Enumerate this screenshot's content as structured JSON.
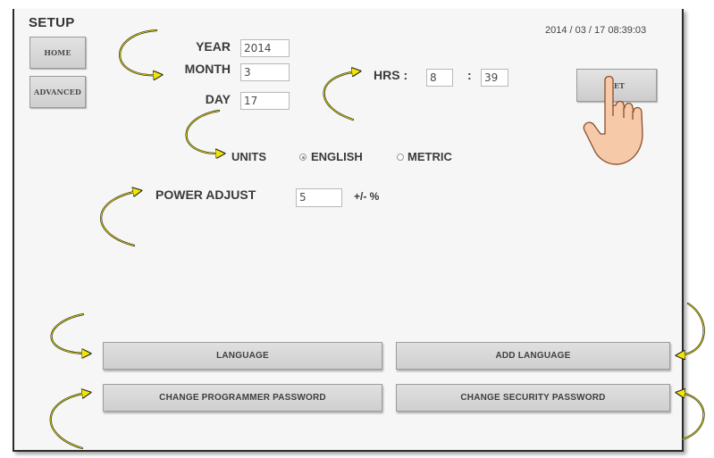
{
  "header": {
    "title": "SETUP",
    "datetime": "2014 / 03 / 17   08:39:03"
  },
  "nav": {
    "home_label": "HOME",
    "advanced_label": "ADVANCED"
  },
  "date": {
    "year_label": "YEAR",
    "year_value": "2014",
    "month_label": "MONTH",
    "month_value": "3",
    "day_label": "DAY",
    "day_value": "17"
  },
  "time": {
    "hrs_label": "HRS :",
    "hours_value": "8",
    "separator": ":",
    "minutes_value": "39"
  },
  "set_label": "SET",
  "units": {
    "label": "UNITS",
    "options": [
      "ENGLISH",
      "METRIC"
    ],
    "selected": "ENGLISH"
  },
  "power": {
    "label": "POWER ADJUST",
    "value": "5",
    "unit": "+/- %"
  },
  "buttons": {
    "language": "LANGUAGE",
    "add_language": "ADD LANGUAGE",
    "change_programmer_password": "CHANGE PROGRAMMER PASSWORD",
    "change_security_password": "CHANGE SECURITY PASSWORD"
  },
  "annotations": {
    "arrow_color": "#f2e600",
    "arrow_outline": "#222222",
    "icons": [
      "curved-arrow-icon",
      "pointing-hand-icon"
    ]
  }
}
